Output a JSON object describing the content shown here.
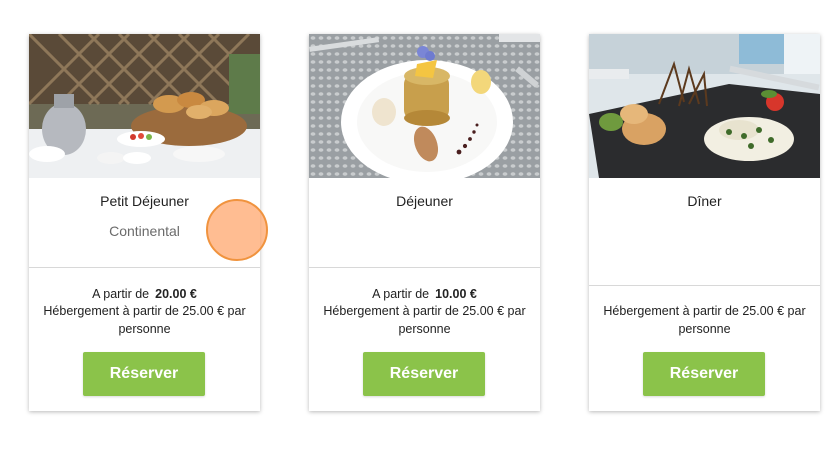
{
  "cards": [
    {
      "title": "Petit Déjeuner",
      "subtitle": "Continental",
      "price_prefix": "A partir de",
      "price": "20.00 €",
      "lodging": "Hébergement à partir de 25.00 € par personne",
      "button": "Réserver"
    },
    {
      "title": "Déjeuner",
      "subtitle": "",
      "price_prefix": "A partir de",
      "price": "10.00 €",
      "lodging": "Hébergement à partir de 25.00 € par personne",
      "button": "Réserver"
    },
    {
      "title": "Dîner",
      "subtitle": "",
      "lodging": "Hébergement à partir de 25.00 € par personne",
      "button": "Réserver"
    }
  ],
  "colors": {
    "button_bg": "#8bc34a",
    "button_text": "#ffffff",
    "cursor_fill": "#ffa76e"
  }
}
